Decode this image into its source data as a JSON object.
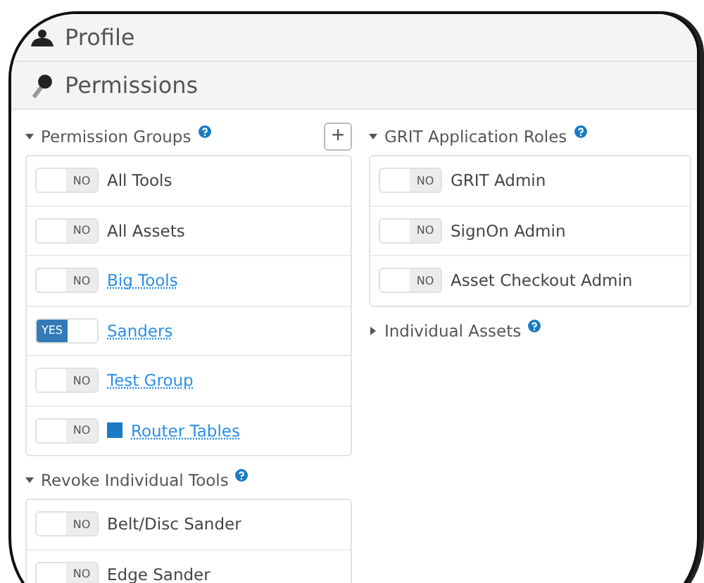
{
  "panels": [
    {
      "title": "Profile"
    },
    {
      "title": "Permissions"
    }
  ],
  "columns": [
    [
      {
        "title": "Permission Groups",
        "expanded": true,
        "add_button": "+",
        "items": [
          {
            "toggle": "NO",
            "on": false,
            "label": "All Tools",
            "link": false
          },
          {
            "toggle": "NO",
            "on": false,
            "label": "All Assets",
            "link": false
          },
          {
            "toggle": "NO",
            "on": false,
            "label": "Big Tools",
            "link": true
          },
          {
            "toggle": "YES",
            "on": true,
            "label": "Sanders",
            "link": true
          },
          {
            "toggle": "NO",
            "on": false,
            "label": "Test Group",
            "link": true
          },
          {
            "toggle": "NO",
            "on": false,
            "label": "Router Tables",
            "link": true,
            "color": "#1a7bc4"
          }
        ]
      },
      {
        "title": "Revoke Individual Tools",
        "expanded": true,
        "items": [
          {
            "toggle": "NO",
            "on": false,
            "label": "Belt/Disc Sander",
            "link": false
          },
          {
            "toggle": "NO",
            "on": false,
            "label": "Edge Sander",
            "link": false
          }
        ]
      }
    ],
    [
      {
        "title": "GRIT Application Roles",
        "expanded": true,
        "items": [
          {
            "toggle": "NO",
            "on": false,
            "label": "GRIT Admin",
            "link": false
          },
          {
            "toggle": "NO",
            "on": false,
            "label": "SignOn Admin",
            "link": false
          },
          {
            "toggle": "NO",
            "on": false,
            "label": "Asset Checkout Admin",
            "link": false
          }
        ]
      },
      {
        "title": "Individual Assets",
        "expanded": false
      }
    ]
  ]
}
